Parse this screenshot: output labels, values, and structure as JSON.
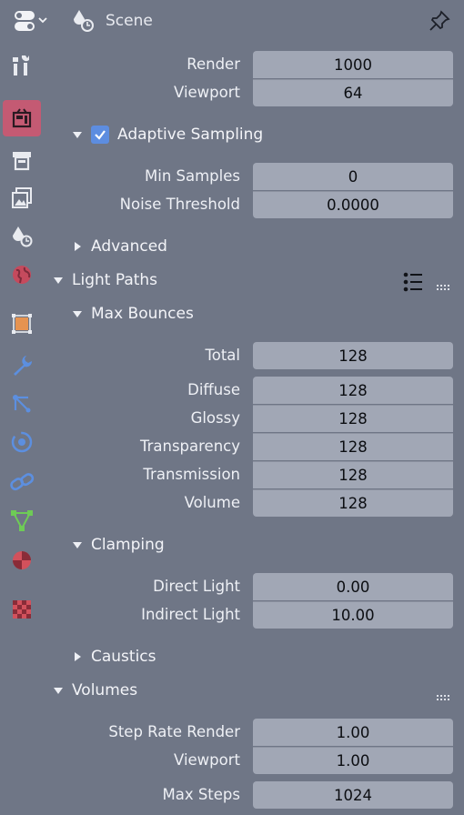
{
  "header": {
    "scene_label": "Scene",
    "editor_icon": "properties-editor-icon",
    "pin_icon": "pin-icon"
  },
  "sidebar": {
    "tabs": [
      {
        "name": "tool-tab",
        "icon": "tool-icon"
      },
      {
        "name": "render-tab",
        "icon": "render-icon",
        "active": true
      },
      {
        "name": "output-tab",
        "icon": "output-icon"
      },
      {
        "name": "view-layer-tab",
        "icon": "view-layer-icon"
      },
      {
        "name": "scene-tab",
        "icon": "scene-icon"
      },
      {
        "name": "world-tab",
        "icon": "world-icon"
      },
      {
        "name": "object-tab",
        "icon": "object-icon"
      },
      {
        "name": "modifier-tab",
        "icon": "wrench-icon"
      },
      {
        "name": "particles-tab",
        "icon": "particles-icon"
      },
      {
        "name": "physics-tab",
        "icon": "physics-icon"
      },
      {
        "name": "constraints-tab",
        "icon": "constraints-icon"
      },
      {
        "name": "data-tab",
        "icon": "mesh-data-icon"
      },
      {
        "name": "material-tab",
        "icon": "material-icon"
      },
      {
        "name": "texture-tab",
        "icon": "texture-icon"
      }
    ],
    "accent": "#c45a73"
  },
  "sampling": {
    "render_label": "Render",
    "render_value": "1000",
    "viewport_label": "Viewport",
    "viewport_value": "64",
    "adaptive_label": "Adaptive Sampling",
    "adaptive_checked": true,
    "min_samples_label": "Min Samples",
    "min_samples_value": "0",
    "noise_threshold_label": "Noise Threshold",
    "noise_threshold_value": "0.0000",
    "advanced_label": "Advanced"
  },
  "light_paths": {
    "title": "Light Paths",
    "max_bounces": {
      "title": "Max Bounces",
      "total_label": "Total",
      "total_value": "128",
      "diffuse_label": "Diffuse",
      "diffuse_value": "128",
      "glossy_label": "Glossy",
      "glossy_value": "128",
      "transparency_label": "Transparency",
      "transparency_value": "128",
      "transmission_label": "Transmission",
      "transmission_value": "128",
      "volume_label": "Volume",
      "volume_value": "128"
    },
    "clamping": {
      "title": "Clamping",
      "direct_label": "Direct Light",
      "direct_value": "0.00",
      "indirect_label": "Indirect Light",
      "indirect_value": "10.00"
    },
    "caustics_label": "Caustics"
  },
  "volumes": {
    "title": "Volumes",
    "step_rate_render_label": "Step Rate Render",
    "step_rate_render_value": "1.00",
    "viewport_label": "Viewport",
    "viewport_value": "1.00",
    "max_steps_label": "Max Steps",
    "max_steps_value": "1024"
  },
  "colors": {
    "background": "#6f7686",
    "field": "#a1a7b5",
    "checkbox": "#5d8de0"
  }
}
